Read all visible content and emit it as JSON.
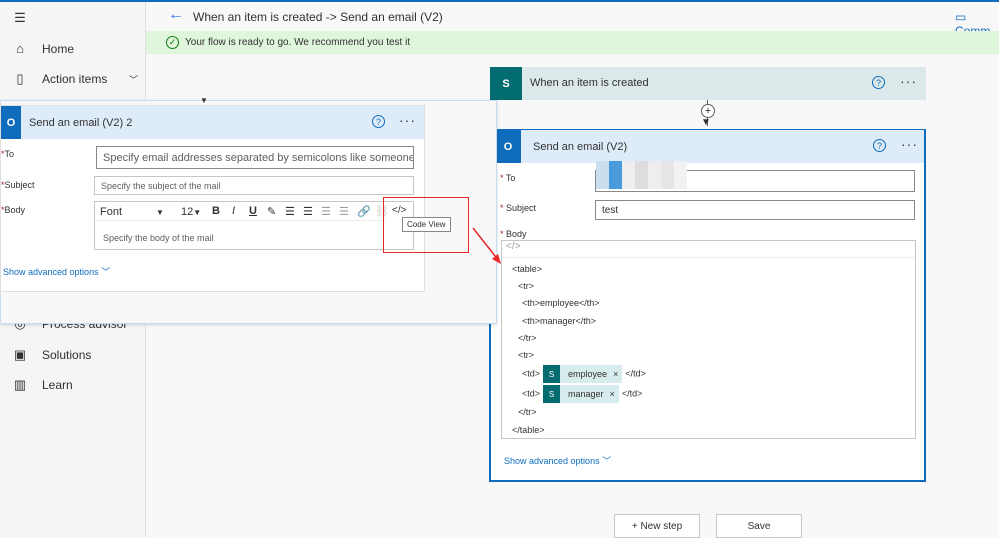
{
  "header": {
    "title": "When an item is created -> Send an email (V2)",
    "comments": "Comm",
    "banner": "Your flow is ready to go. We recommend you test it"
  },
  "sidebar": {
    "items": [
      {
        "label": "Home",
        "icon": "home-icon"
      },
      {
        "label": "Action items",
        "icon": "clipboard-icon"
      },
      {
        "label": "Process advisor",
        "icon": "process-advisor-icon"
      },
      {
        "label": "Solutions",
        "icon": "solutions-icon"
      },
      {
        "label": "Learn",
        "icon": "book-icon"
      }
    ]
  },
  "trigger": {
    "title": "When an item is created"
  },
  "floating_card": {
    "title": "Send an email (V2) 2",
    "to_label": "To",
    "to_placeholder": "Specify email addresses separated by semicolons like someone@con",
    "subject_label": "Subject",
    "subject_placeholder": "Specify the subject of the mail",
    "body_label": "Body",
    "font": "Font",
    "size": "12",
    "body_placeholder": "Specify the body of the mail",
    "tooltip": "Code View",
    "advanced": "Show advanced options"
  },
  "main_card": {
    "title": "Send an email (V2)",
    "to_label": "To",
    "subject_label": "Subject",
    "subject_value": "test",
    "body_label": "Body",
    "code_lines": [
      "<table>",
      "<tr>",
      "<th>employee</th>",
      "<th>manager</th>",
      "</tr>",
      "<tr>",
      "</tr>",
      "</table>"
    ],
    "td_open": "<td>",
    "td_close": "</td>",
    "tokens": [
      "employee",
      "manager"
    ],
    "advanced": "Show advanced options"
  },
  "buttons": {
    "new_step": "+ New step",
    "save": "Save"
  },
  "colors": {
    "accent": "#0f6cbd",
    "sharepoint": "#036c70",
    "banner": "#dff6dd",
    "highlight": "#e8272b"
  }
}
